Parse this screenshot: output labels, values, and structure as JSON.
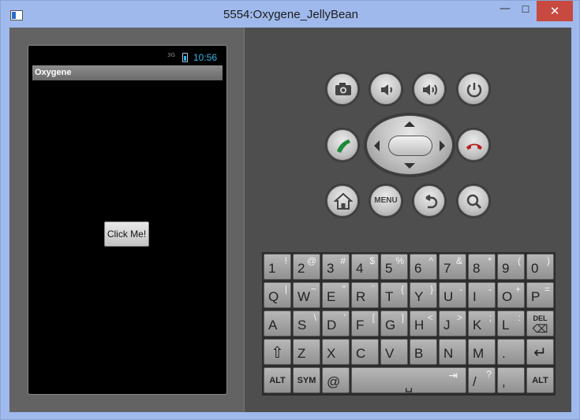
{
  "window": {
    "title": "5554:Oxygene_JellyBean",
    "minimize": "—",
    "maximize": "☐",
    "close": "✕"
  },
  "device": {
    "status": {
      "network": "3G",
      "time": "10:56"
    },
    "app_title": "Oxygene",
    "button_label": "Click Me!"
  },
  "hardware": {
    "menu_label": "MENU"
  },
  "keyboard": {
    "rows": [
      [
        {
          "m": "1",
          "s": "!"
        },
        {
          "m": "2",
          "s": "@"
        },
        {
          "m": "3",
          "s": "#"
        },
        {
          "m": "4",
          "s": "$"
        },
        {
          "m": "5",
          "s": "%"
        },
        {
          "m": "6",
          "s": "^"
        },
        {
          "m": "7",
          "s": "&"
        },
        {
          "m": "8",
          "s": "*"
        },
        {
          "m": "9",
          "s": "("
        },
        {
          "m": "0",
          "s": ")"
        }
      ],
      [
        {
          "m": "Q",
          "s": "|"
        },
        {
          "m": "W",
          "s": "~"
        },
        {
          "m": "E",
          "s": "\""
        },
        {
          "m": "R",
          "s": "`"
        },
        {
          "m": "T",
          "s": "{"
        },
        {
          "m": "Y",
          "s": "}"
        },
        {
          "m": "U",
          "s": "-"
        },
        {
          "m": "I",
          "s": "-"
        },
        {
          "m": "O",
          "s": "+"
        },
        {
          "m": "P",
          "s": "="
        }
      ],
      [
        {
          "m": "A",
          "s": ""
        },
        {
          "m": "S",
          "s": "\\"
        },
        {
          "m": "D",
          "s": "'"
        },
        {
          "m": "F",
          "s": "["
        },
        {
          "m": "G",
          "s": "]"
        },
        {
          "m": "H",
          "s": "<"
        },
        {
          "m": "J",
          "s": ">"
        },
        {
          "m": "K",
          "s": ";"
        },
        {
          "m": "L",
          "s": ":"
        },
        {
          "m": "DEL",
          "s": ""
        }
      ],
      [
        {
          "m": "⇧",
          "s": ""
        },
        {
          "m": "Z",
          "s": ""
        },
        {
          "m": "X",
          "s": ""
        },
        {
          "m": "C",
          "s": ""
        },
        {
          "m": "V",
          "s": ""
        },
        {
          "m": "B",
          "s": ""
        },
        {
          "m": "N",
          "s": ""
        },
        {
          "m": "M",
          "s": ""
        },
        {
          "m": ".",
          "s": ""
        },
        {
          "m": "↵",
          "s": ""
        }
      ],
      [
        {
          "m": "ALT",
          "s": ""
        },
        {
          "m": "SYM",
          "s": ""
        },
        {
          "m": "@",
          "s": ""
        },
        {
          "m": "",
          "s": ""
        },
        {
          "m": "/",
          "s": "?"
        },
        {
          "m": ",",
          "s": ""
        },
        {
          "m": "ALT",
          "s": ""
        }
      ]
    ]
  },
  "colors": {
    "title_bar": "#9fb9ec",
    "close_button": "#c7493f",
    "clock": "#33b5e5",
    "call_green": "#1f8a3a",
    "end_red": "#b62020"
  }
}
